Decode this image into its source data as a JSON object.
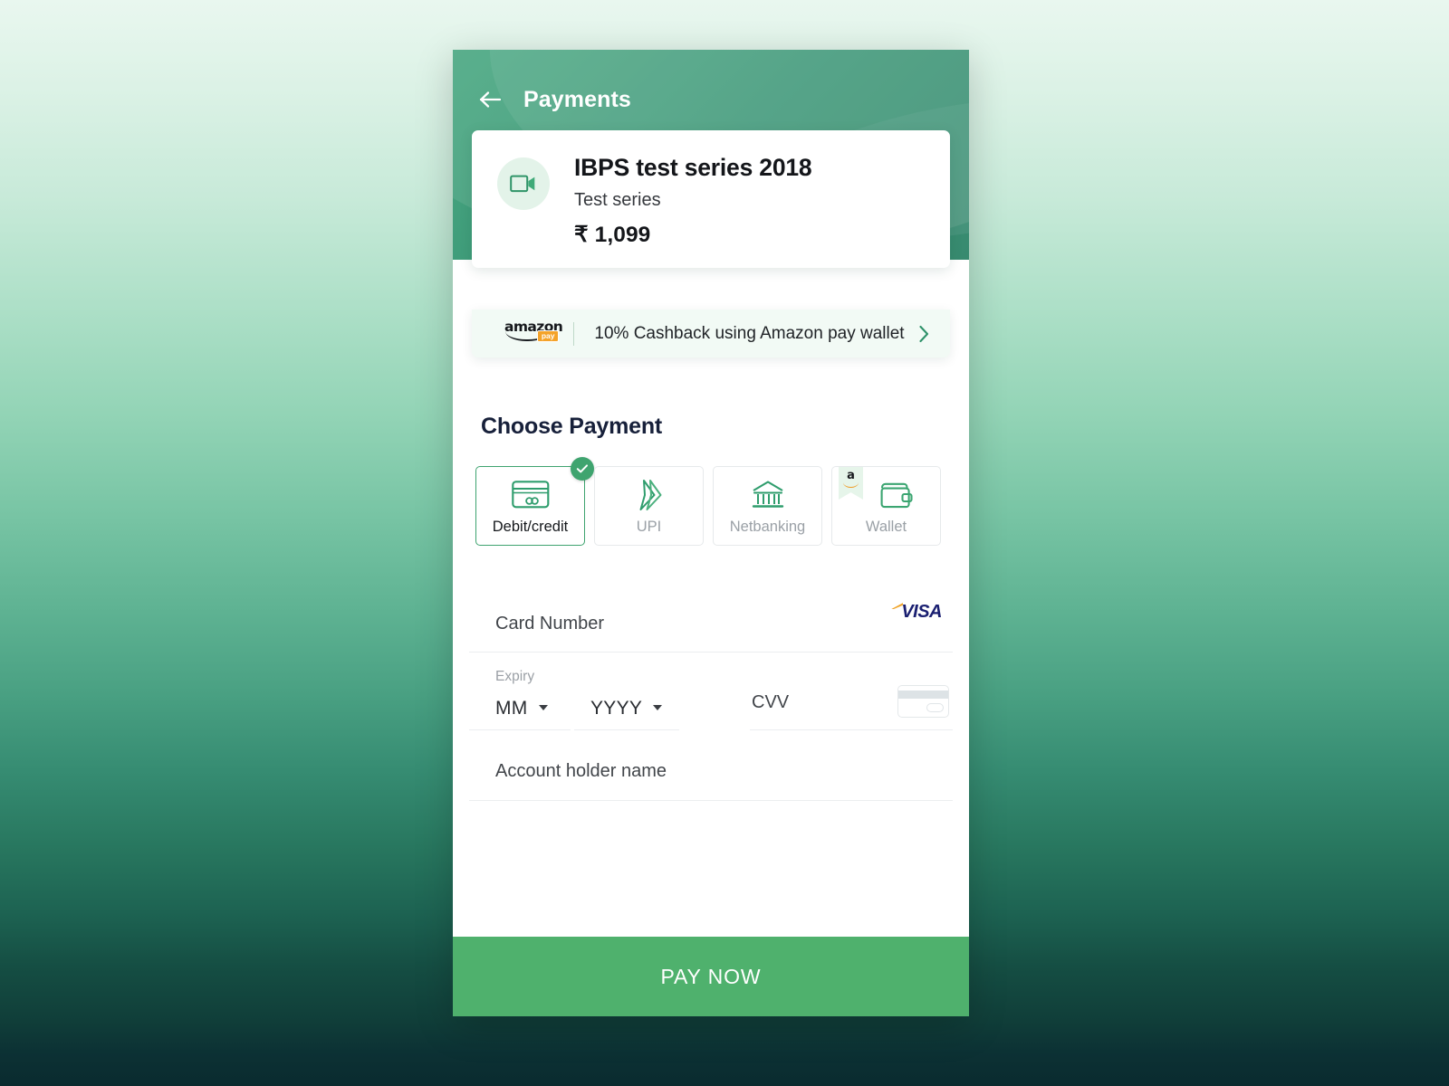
{
  "header": {
    "title": "Payments",
    "back_icon": "arrow-left-icon",
    "accent_color": "#3e9b79"
  },
  "product": {
    "icon": "video-camera-icon",
    "title": "IBPS test series 2018",
    "subtitle": "Test series",
    "price": "₹ 1,099"
  },
  "cashback": {
    "brand": "amazon",
    "badge": "pay",
    "text": "10% Cashback using Amazon pay wallet",
    "chevron_icon": "chevron-right-icon",
    "background": "#f2faf5"
  },
  "choose_payment": {
    "heading": "Choose Payment",
    "methods": [
      {
        "label": "Debit/credit",
        "icon": "credit-card-icon",
        "selected": true,
        "badge_icon": "check-icon"
      },
      {
        "label": "UPI",
        "icon": "upi-arrows-icon",
        "selected": false
      },
      {
        "label": "Netbanking",
        "icon": "bank-building-icon",
        "selected": false
      },
      {
        "label": "Wallet",
        "icon": "wallet-icon",
        "selected": false,
        "ribbon": {
          "letter": "a",
          "brand": "amazon-pay"
        }
      }
    ],
    "selected_color": "#3ea36f"
  },
  "card_form": {
    "card_number_placeholder": "Card Number",
    "card_brand": "VISA",
    "expiry_label": "Expiry",
    "expiry_month": "MM",
    "expiry_year": "YYYY",
    "cvv_placeholder": "CVV",
    "cvv_hint_icon": "card-back-cvv-icon",
    "account_holder_placeholder": "Account holder name"
  },
  "footer": {
    "pay_label": "PAY NOW",
    "pay_color": "#4fb16d"
  }
}
